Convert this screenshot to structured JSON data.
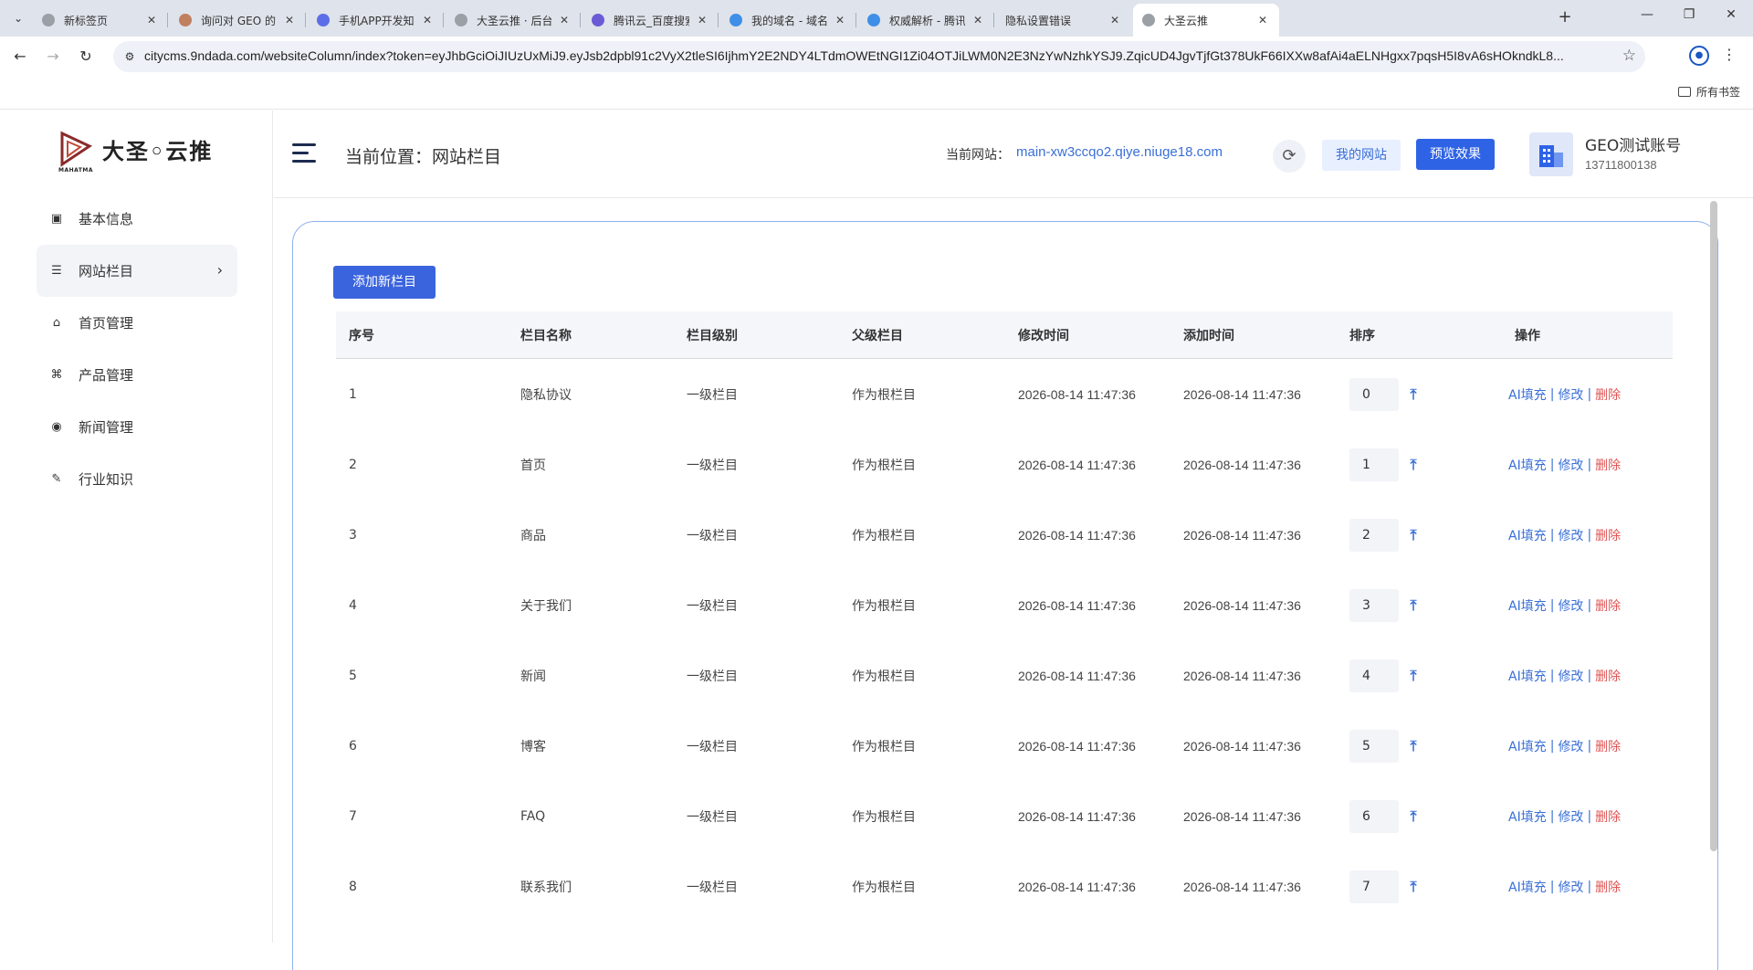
{
  "browser": {
    "tabs": [
      {
        "title": "新标签页",
        "active": false
      },
      {
        "title": "询问对 GEO 的了解 -",
        "active": false
      },
      {
        "title": "手机APP开发知识 - D",
        "active": false
      },
      {
        "title": "大圣云推 · 后台管理",
        "active": false
      },
      {
        "title": "腾讯云_百度搜索",
        "active": false
      },
      {
        "title": "我的域名 - 域名注册",
        "active": false
      },
      {
        "title": "权威解析 - 腾讯云 DI",
        "active": false
      },
      {
        "title": "隐私设置错误",
        "active": false
      },
      {
        "title": "大圣云推",
        "active": true
      }
    ],
    "url": "citycms.9ndada.com/websiteColumn/index?token=eyJhbGciOiJIUzUxMiJ9.eyJsb2dpbl91c2VyX2tleSI6IjhmY2E2NDY4LTdmOWEtNGI1Zi04OTJiLWM0N2E3NzYwNzhkYSJ9.ZqicUD4JgvTjfGt378UkF66IXXw8afAi4aELNHgxx7pqsH5I8vA6sHOkndkL8...",
    "bookmarks_all": "所有书签",
    "accent": "#1a56c4"
  },
  "app": {
    "brand": "大圣◦云推",
    "brand_sub": "MAHATMA",
    "sidebar": {
      "items": [
        {
          "label": "基本信息",
          "icon": "id-card-icon"
        },
        {
          "label": "网站栏目",
          "icon": "list-icon",
          "active": true
        },
        {
          "label": "首页管理",
          "icon": "home-icon"
        },
        {
          "label": "产品管理",
          "icon": "product-icon"
        },
        {
          "label": "新闻管理",
          "icon": "news-icon"
        },
        {
          "label": "行业知识",
          "icon": "graduation-cap-icon"
        }
      ]
    },
    "header": {
      "breadcrumb": "当前位置：网站栏目",
      "current_site_label": "当前网站：",
      "current_site_url": "main-xw3ccqo2.qiye.niuge18.com",
      "my_site_button": "我的网站",
      "preview_button": "预览效果",
      "account_name": "GEO测试账号",
      "account_phone": "13711800138"
    },
    "content": {
      "add_button": "添加新栏目",
      "columns": [
        "序号",
        "栏目名称",
        "栏目级别",
        "父级栏目",
        "修改时间",
        "添加时间",
        "排序",
        "操作"
      ],
      "rows": [
        {
          "no": "1",
          "name": "隐私协议",
          "level": "一级栏目",
          "parent": "作为根栏目",
          "modified": "2026-08-14 11:47:36",
          "added": "2026-08-14 11:47:36",
          "sort": "0"
        },
        {
          "no": "2",
          "name": "首页",
          "level": "一级栏目",
          "parent": "作为根栏目",
          "modified": "2026-08-14 11:47:36",
          "added": "2026-08-14 11:47:36",
          "sort": "1"
        },
        {
          "no": "3",
          "name": "商品",
          "level": "一级栏目",
          "parent": "作为根栏目",
          "modified": "2026-08-14 11:47:36",
          "added": "2026-08-14 11:47:36",
          "sort": "2"
        },
        {
          "no": "4",
          "name": "关于我们",
          "level": "一级栏目",
          "parent": "作为根栏目",
          "modified": "2026-08-14 11:47:36",
          "added": "2026-08-14 11:47:36",
          "sort": "3"
        },
        {
          "no": "5",
          "name": "新闻",
          "level": "一级栏目",
          "parent": "作为根栏目",
          "modified": "2026-08-14 11:47:36",
          "added": "2026-08-14 11:47:36",
          "sort": "4"
        },
        {
          "no": "6",
          "name": "博客",
          "level": "一级栏目",
          "parent": "作为根栏目",
          "modified": "2026-08-14 11:47:36",
          "added": "2026-08-14 11:47:36",
          "sort": "5"
        },
        {
          "no": "7",
          "name": "FAQ",
          "level": "一级栏目",
          "parent": "作为根栏目",
          "modified": "2026-08-14 11:47:36",
          "added": "2026-08-14 11:47:36",
          "sort": "6"
        },
        {
          "no": "8",
          "name": "联系我们",
          "level": "一级栏目",
          "parent": "作为根栏目",
          "modified": "2026-08-14 11:47:36",
          "added": "2026-08-14 11:47:36",
          "sort": "7"
        }
      ],
      "ops": {
        "ai_fill": "AI填充",
        "edit": "修改",
        "delete": "删除",
        "separator": "|"
      },
      "colors": {
        "primary": "#3a64de",
        "link": "#3a6fd6",
        "danger": "#e05656"
      }
    }
  }
}
